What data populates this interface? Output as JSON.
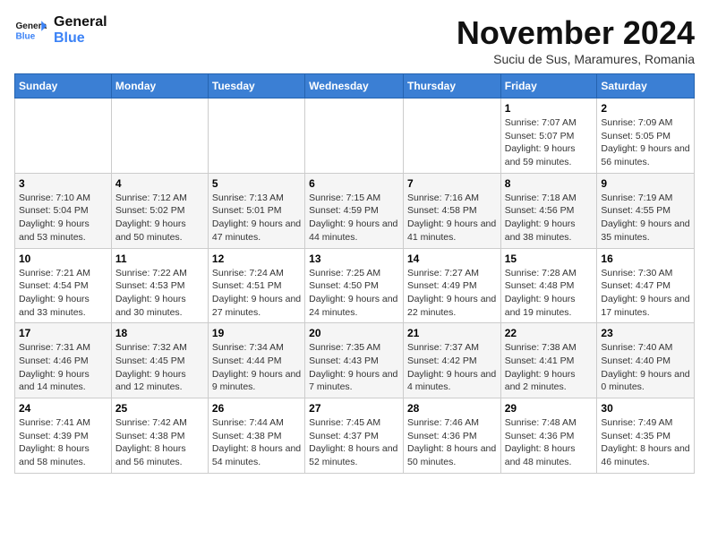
{
  "logo": {
    "line1": "General",
    "line2": "Blue"
  },
  "title": "November 2024",
  "subtitle": "Suciu de Sus, Maramures, Romania",
  "days_of_week": [
    "Sunday",
    "Monday",
    "Tuesday",
    "Wednesday",
    "Thursday",
    "Friday",
    "Saturday"
  ],
  "weeks": [
    [
      {
        "day": "",
        "info": ""
      },
      {
        "day": "",
        "info": ""
      },
      {
        "day": "",
        "info": ""
      },
      {
        "day": "",
        "info": ""
      },
      {
        "day": "",
        "info": ""
      },
      {
        "day": "1",
        "info": "Sunrise: 7:07 AM\nSunset: 5:07 PM\nDaylight: 9 hours and 59 minutes."
      },
      {
        "day": "2",
        "info": "Sunrise: 7:09 AM\nSunset: 5:05 PM\nDaylight: 9 hours and 56 minutes."
      }
    ],
    [
      {
        "day": "3",
        "info": "Sunrise: 7:10 AM\nSunset: 5:04 PM\nDaylight: 9 hours and 53 minutes."
      },
      {
        "day": "4",
        "info": "Sunrise: 7:12 AM\nSunset: 5:02 PM\nDaylight: 9 hours and 50 minutes."
      },
      {
        "day": "5",
        "info": "Sunrise: 7:13 AM\nSunset: 5:01 PM\nDaylight: 9 hours and 47 minutes."
      },
      {
        "day": "6",
        "info": "Sunrise: 7:15 AM\nSunset: 4:59 PM\nDaylight: 9 hours and 44 minutes."
      },
      {
        "day": "7",
        "info": "Sunrise: 7:16 AM\nSunset: 4:58 PM\nDaylight: 9 hours and 41 minutes."
      },
      {
        "day": "8",
        "info": "Sunrise: 7:18 AM\nSunset: 4:56 PM\nDaylight: 9 hours and 38 minutes."
      },
      {
        "day": "9",
        "info": "Sunrise: 7:19 AM\nSunset: 4:55 PM\nDaylight: 9 hours and 35 minutes."
      }
    ],
    [
      {
        "day": "10",
        "info": "Sunrise: 7:21 AM\nSunset: 4:54 PM\nDaylight: 9 hours and 33 minutes."
      },
      {
        "day": "11",
        "info": "Sunrise: 7:22 AM\nSunset: 4:53 PM\nDaylight: 9 hours and 30 minutes."
      },
      {
        "day": "12",
        "info": "Sunrise: 7:24 AM\nSunset: 4:51 PM\nDaylight: 9 hours and 27 minutes."
      },
      {
        "day": "13",
        "info": "Sunrise: 7:25 AM\nSunset: 4:50 PM\nDaylight: 9 hours and 24 minutes."
      },
      {
        "day": "14",
        "info": "Sunrise: 7:27 AM\nSunset: 4:49 PM\nDaylight: 9 hours and 22 minutes."
      },
      {
        "day": "15",
        "info": "Sunrise: 7:28 AM\nSunset: 4:48 PM\nDaylight: 9 hours and 19 minutes."
      },
      {
        "day": "16",
        "info": "Sunrise: 7:30 AM\nSunset: 4:47 PM\nDaylight: 9 hours and 17 minutes."
      }
    ],
    [
      {
        "day": "17",
        "info": "Sunrise: 7:31 AM\nSunset: 4:46 PM\nDaylight: 9 hours and 14 minutes."
      },
      {
        "day": "18",
        "info": "Sunrise: 7:32 AM\nSunset: 4:45 PM\nDaylight: 9 hours and 12 minutes."
      },
      {
        "day": "19",
        "info": "Sunrise: 7:34 AM\nSunset: 4:44 PM\nDaylight: 9 hours and 9 minutes."
      },
      {
        "day": "20",
        "info": "Sunrise: 7:35 AM\nSunset: 4:43 PM\nDaylight: 9 hours and 7 minutes."
      },
      {
        "day": "21",
        "info": "Sunrise: 7:37 AM\nSunset: 4:42 PM\nDaylight: 9 hours and 4 minutes."
      },
      {
        "day": "22",
        "info": "Sunrise: 7:38 AM\nSunset: 4:41 PM\nDaylight: 9 hours and 2 minutes."
      },
      {
        "day": "23",
        "info": "Sunrise: 7:40 AM\nSunset: 4:40 PM\nDaylight: 9 hours and 0 minutes."
      }
    ],
    [
      {
        "day": "24",
        "info": "Sunrise: 7:41 AM\nSunset: 4:39 PM\nDaylight: 8 hours and 58 minutes."
      },
      {
        "day": "25",
        "info": "Sunrise: 7:42 AM\nSunset: 4:38 PM\nDaylight: 8 hours and 56 minutes."
      },
      {
        "day": "26",
        "info": "Sunrise: 7:44 AM\nSunset: 4:38 PM\nDaylight: 8 hours and 54 minutes."
      },
      {
        "day": "27",
        "info": "Sunrise: 7:45 AM\nSunset: 4:37 PM\nDaylight: 8 hours and 52 minutes."
      },
      {
        "day": "28",
        "info": "Sunrise: 7:46 AM\nSunset: 4:36 PM\nDaylight: 8 hours and 50 minutes."
      },
      {
        "day": "29",
        "info": "Sunrise: 7:48 AM\nSunset: 4:36 PM\nDaylight: 8 hours and 48 minutes."
      },
      {
        "day": "30",
        "info": "Sunrise: 7:49 AM\nSunset: 4:35 PM\nDaylight: 8 hours and 46 minutes."
      }
    ]
  ],
  "colors": {
    "header_bg": "#3b7fd4",
    "header_text": "#ffffff"
  }
}
